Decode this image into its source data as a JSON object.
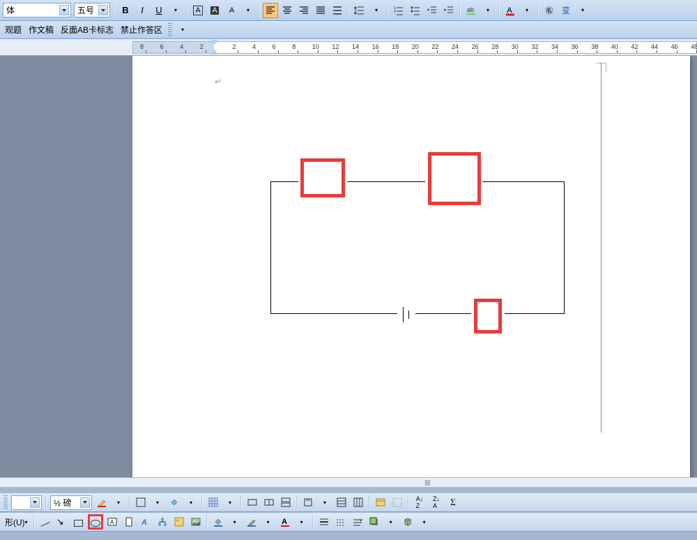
{
  "toolbar1": {
    "font_family_suffix": "体",
    "font_size": "五号",
    "bold": "B",
    "italic": "I",
    "underline": "U",
    "aa": "A",
    "align_labels": [
      "left",
      "center",
      "right",
      "justify"
    ]
  },
  "toolbar2": {
    "items": [
      "观题",
      "作文稿",
      "反面AB卡标志",
      "禁止作答区"
    ]
  },
  "ruler": {
    "labels": [
      "8",
      "6",
      "4",
      "2",
      "2",
      "4",
      "6",
      "8",
      "10",
      "12",
      "14",
      "16",
      "18",
      "20",
      "22",
      "24",
      "26",
      "28",
      "30",
      "32",
      "34",
      "36",
      "38",
      "40",
      "42",
      "44",
      "46",
      "48"
    ],
    "margin_break_index": 3
  },
  "bottom_tb1": {
    "line_weight": "½ 磅",
    "sigma": "Σ"
  },
  "bottom_tb2": {
    "shape_menu": "形(U)"
  },
  "colors": {
    "accent": "#eb3a3a",
    "panel": "#b8d0ec"
  }
}
